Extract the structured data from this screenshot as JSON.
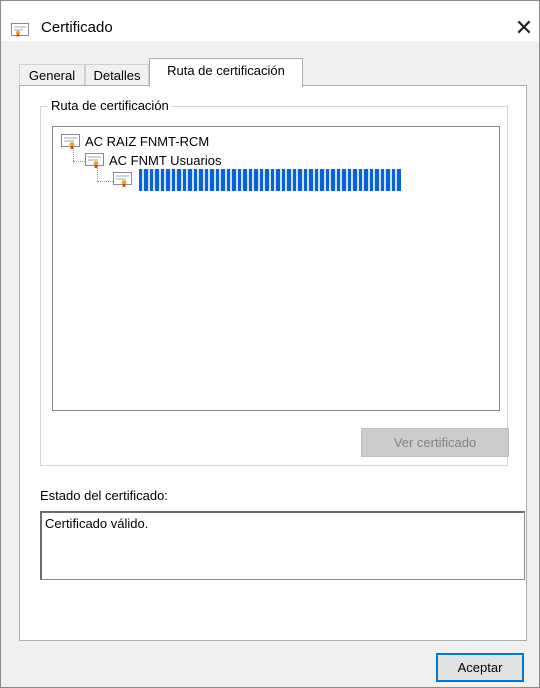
{
  "window": {
    "title": "Certificado"
  },
  "tabs": [
    {
      "label": "General",
      "active": false
    },
    {
      "label": "Detalles",
      "active": false
    },
    {
      "label": "Ruta de certificación",
      "active": true
    }
  ],
  "path_group": {
    "legend": "Ruta de certificación",
    "tree": [
      {
        "label": "AC RAIZ FNMT-RCM",
        "level": 0
      },
      {
        "label": "AC FNMT Usuarios",
        "level": 1
      },
      {
        "label": "",
        "level": 2,
        "redacted": true
      }
    ],
    "view_button": "Ver certificado"
  },
  "status": {
    "label": "Estado del certificado:",
    "text": "Certificado válido."
  },
  "ok_button": "Aceptar",
  "colors": {
    "selection": "#0a62d4",
    "accent_border": "#0078d7"
  }
}
